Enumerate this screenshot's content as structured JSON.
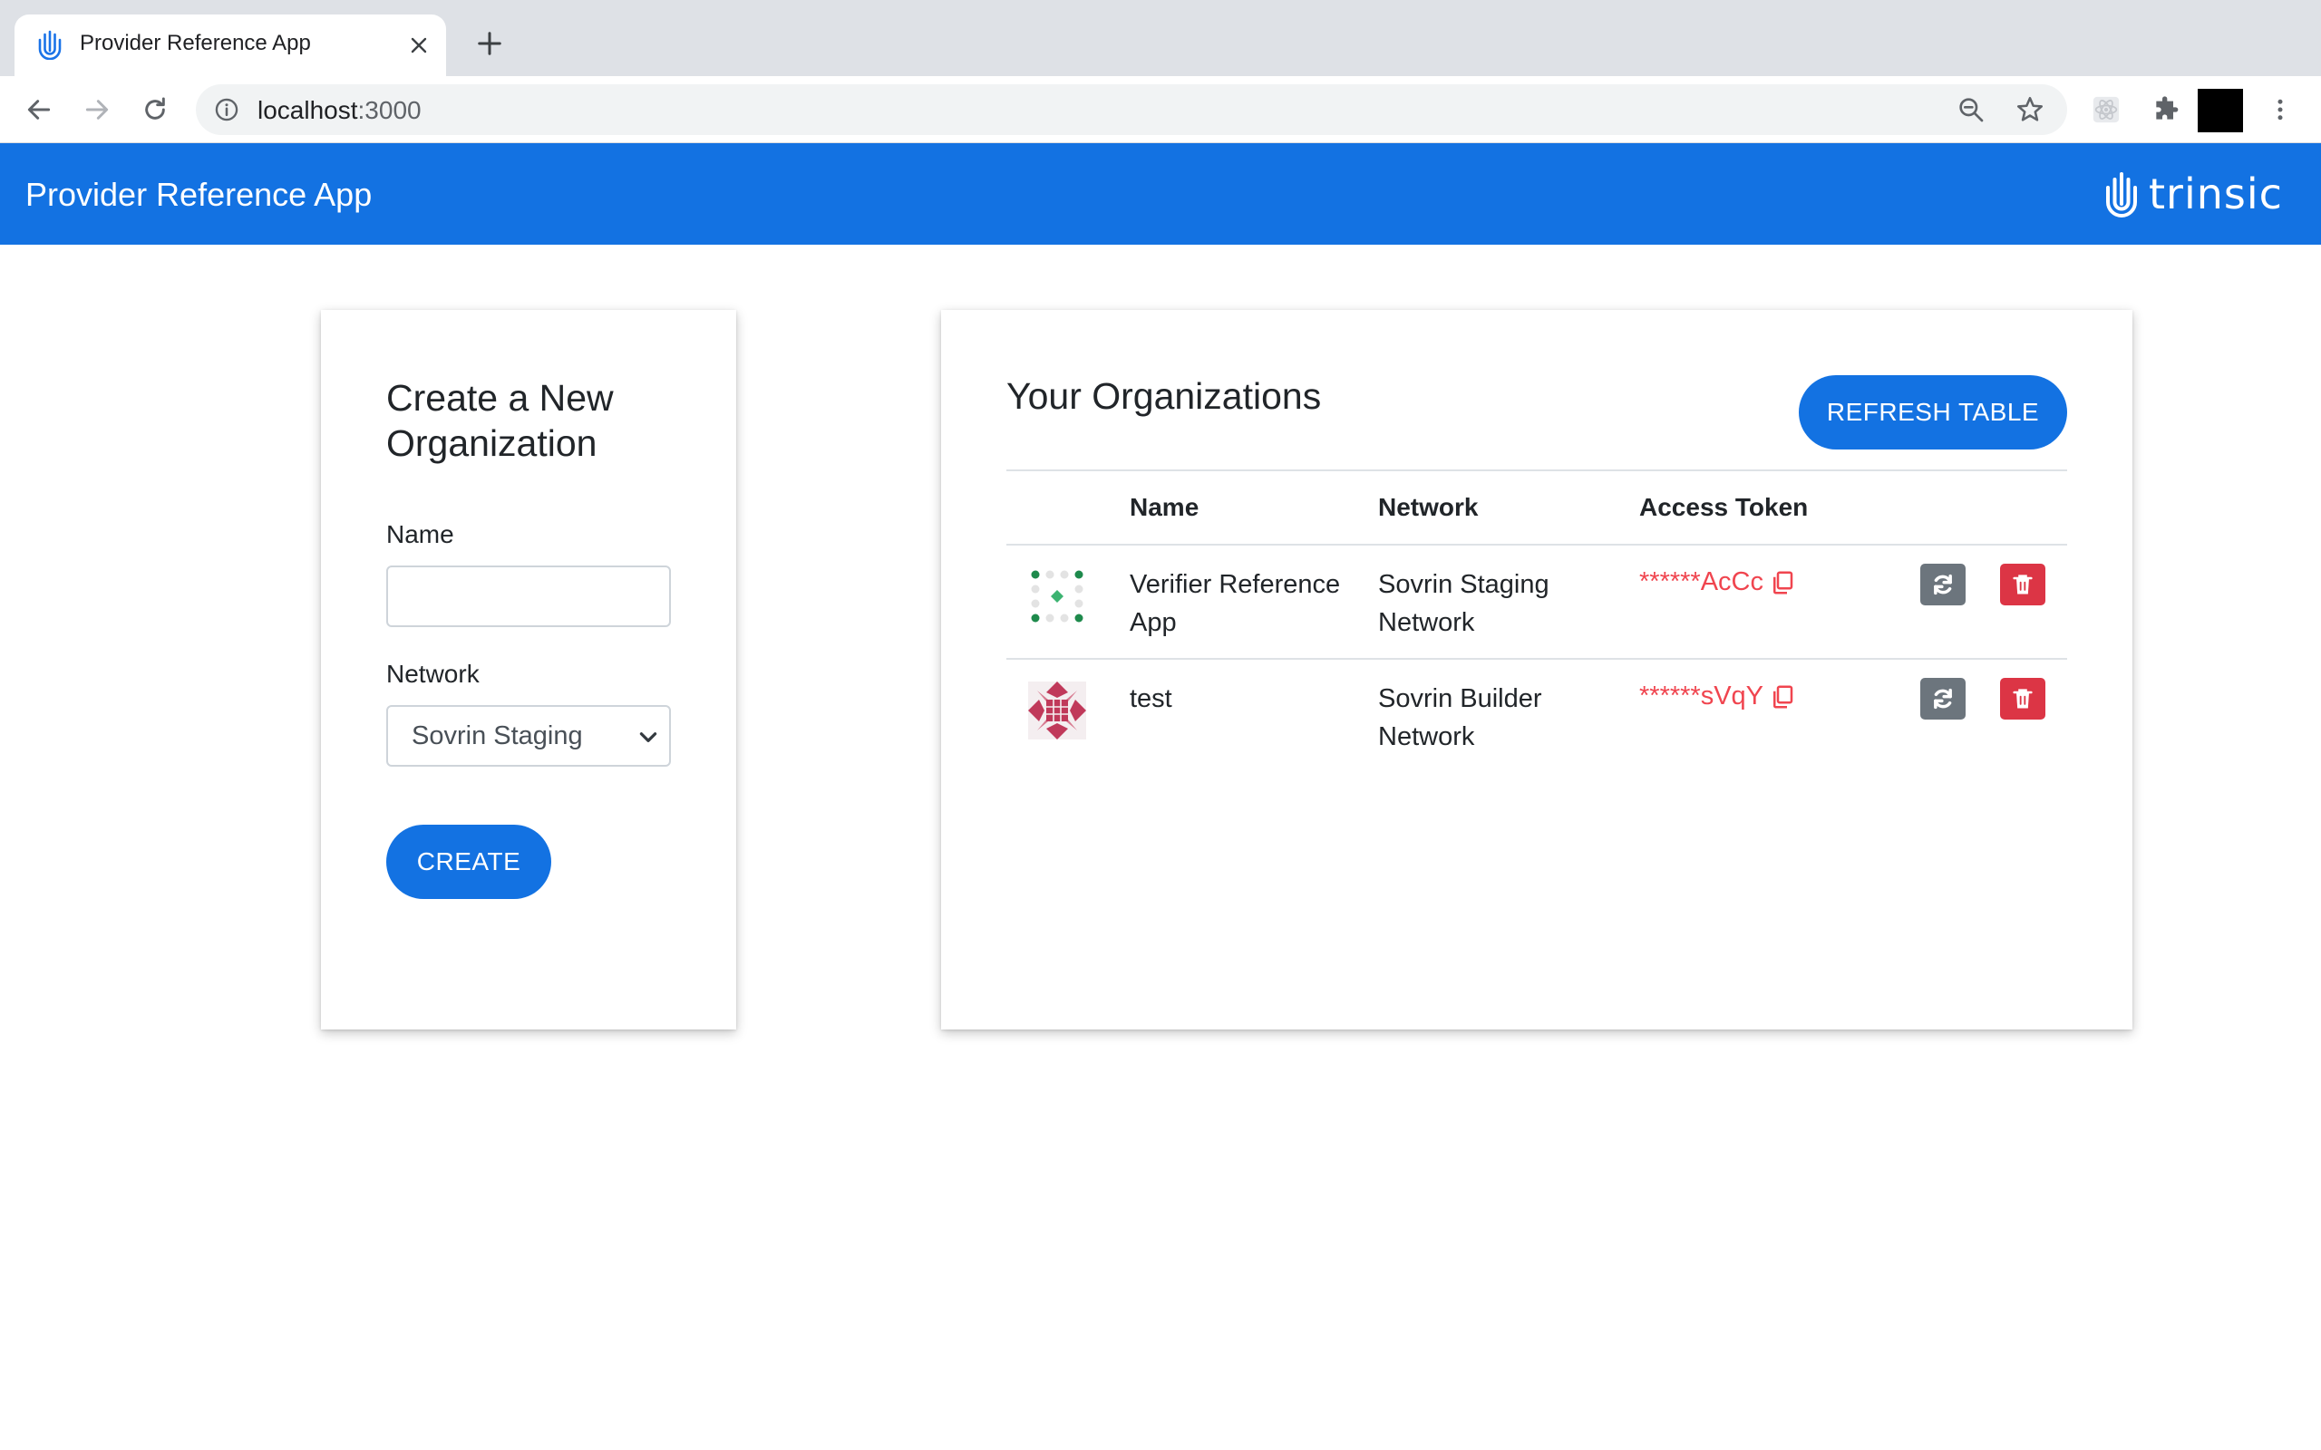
{
  "browser": {
    "tab_title": "Provider Reference App",
    "url_host": "localhost",
    "url_port": ":3000"
  },
  "navbar": {
    "title": "Provider Reference App",
    "brand": "trinsic"
  },
  "create_form": {
    "title": "Create a New Organization",
    "name_label": "Name",
    "name_value": "",
    "network_label": "Network",
    "network_selected": "Sovrin Staging",
    "create_label": "CREATE"
  },
  "orgs": {
    "title": "Your Organizations",
    "refresh_label": "REFRESH TABLE",
    "headers": {
      "name": "Name",
      "network": "Network",
      "token": "Access Token"
    },
    "rows": [
      {
        "name": "Verifier Reference App",
        "network": "Sovrin Staging Network",
        "token": "******AcCc"
      },
      {
        "name": "test",
        "network": "Sovrin Builder Network",
        "token": "******sVqY"
      }
    ]
  },
  "colors": {
    "primary": "#1372e2",
    "danger": "#dc3545",
    "secondary": "#6c757d",
    "token": "#f0454f"
  }
}
